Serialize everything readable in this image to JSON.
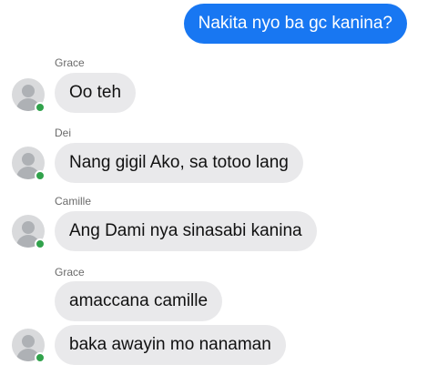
{
  "colors": {
    "accent": "#1877f2",
    "incoming_bubble": "#e9e9eb",
    "online": "#31a24c"
  },
  "messages": {
    "outgoing": "Nakita nyo ba gc kanina?",
    "groups": [
      {
        "sender": "Grace",
        "texts": [
          "Oo teh"
        ]
      },
      {
        "sender": "Dei",
        "texts": [
          "Nang gigil Ako, sa totoo lang"
        ]
      },
      {
        "sender": "Camille",
        "texts": [
          "Ang Dami nya sinasabi kanina"
        ]
      },
      {
        "sender": "Grace",
        "texts": [
          "amaccana camille",
          "baka awayin mo nanaman"
        ]
      }
    ]
  },
  "icons": {
    "avatar": "default-user-avatar-icon",
    "presence": "online-status-dot-icon"
  }
}
